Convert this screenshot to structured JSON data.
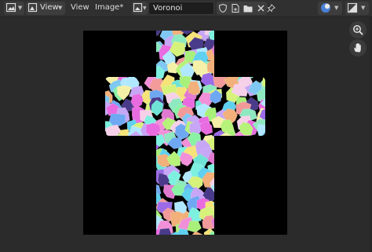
{
  "header": {
    "editor_type_icon": "image-editor-icon",
    "view_mode_icon": "view-mode-icon",
    "view_dropdown_label": "View",
    "menu_view_label": "View",
    "menu_image_label": "Image*",
    "image_browse_icon": "image-browse-icon",
    "image_name_value": "Voronoi",
    "fake_user_icon": "shield-icon",
    "new_image_icon": "new-image-icon",
    "open_image_icon": "folder-icon",
    "unlink_icon": "close-icon",
    "pin_icon": "pin-icon",
    "overlay_icon": "overlay-icon",
    "display_channels_icon": "display-channels-icon"
  },
  "gizmos": {
    "zoom_icon": "zoom-icon",
    "pan_icon": "hand-icon"
  },
  "image": {
    "background_color": "#000000",
    "texture": "voronoi colorful mosaic",
    "shape": "cross"
  },
  "colors": {
    "header_bg": "#303030",
    "editor_bg": "#2b2b2b",
    "field_bg": "#1d1d1d",
    "accent_blue": "#4a7fd6"
  }
}
